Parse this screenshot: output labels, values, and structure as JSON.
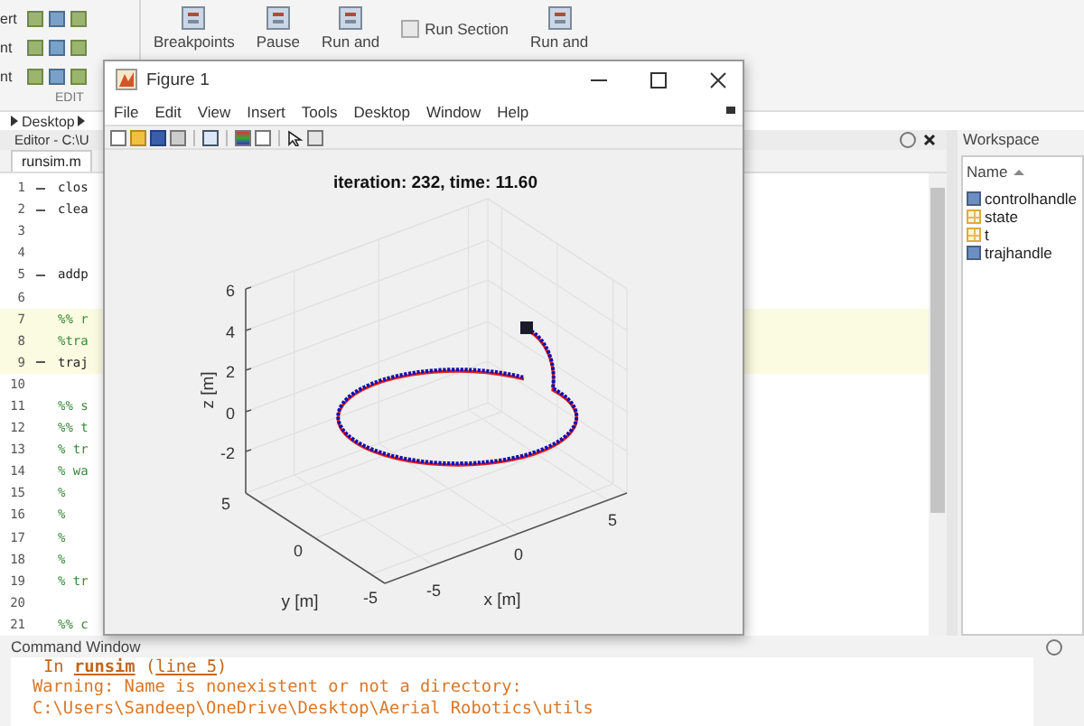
{
  "toolstrip": {
    "edit_rows": [
      "ert",
      "nt",
      "nt"
    ],
    "section_label": "EDIT",
    "buttons": [
      {
        "kind": "big",
        "label": "Breakpoints"
      },
      {
        "kind": "big",
        "label": "Pause"
      },
      {
        "kind": "big",
        "label": "Run and"
      },
      {
        "kind": "small",
        "label": "Run Section"
      },
      {
        "kind": "big",
        "label": "Run and"
      }
    ]
  },
  "address_bar": {
    "path": [
      "Desktop"
    ]
  },
  "editor": {
    "title": "Editor - C:\\U",
    "tabs": [
      {
        "label": "runsim.m",
        "selected": true
      }
    ],
    "lines": [
      {
        "number": "1",
        "executable": true,
        "cell": false,
        "code": "clos"
      },
      {
        "number": "2",
        "executable": true,
        "cell": false,
        "code": "clea"
      },
      {
        "number": "3",
        "executable": false,
        "cell": false
      },
      {
        "number": "4",
        "executable": false,
        "cell": false
      },
      {
        "number": "5",
        "executable": true,
        "cell": false,
        "code": "addp"
      },
      {
        "number": "6",
        "executable": false,
        "cell": false
      },
      {
        "number": "7",
        "executable": false,
        "cell": true,
        "code": "%% r"
      },
      {
        "number": "8",
        "executable": false,
        "cell": true,
        "code": "%tra"
      },
      {
        "number": "9",
        "executable": true,
        "cell": true,
        "code": "traj"
      },
      {
        "number": "10",
        "executable": false,
        "cell": false
      },
      {
        "number": "11",
        "executable": false,
        "cell": false,
        "code": "%% s"
      },
      {
        "number": "12",
        "executable": false,
        "cell": false,
        "code": "%% t"
      },
      {
        "number": "13",
        "executable": false,
        "cell": false,
        "code": "% tr"
      },
      {
        "number": "14",
        "executable": false,
        "cell": false,
        "code": "% wa"
      },
      {
        "number": "15",
        "executable": false,
        "cell": false,
        "code": "%"
      },
      {
        "number": "16",
        "executable": false,
        "cell": false,
        "code": "%"
      },
      {
        "number": "17",
        "executable": false,
        "cell": false,
        "code": "%"
      },
      {
        "number": "18",
        "executable": false,
        "cell": false,
        "code": "%"
      },
      {
        "number": "19",
        "executable": false,
        "cell": false,
        "code": "% tr"
      },
      {
        "number": "20",
        "executable": false,
        "cell": false
      },
      {
        "number": "21",
        "executable": false,
        "cell": false,
        "code": "%% c"
      }
    ]
  },
  "figure": {
    "title": "Figure 1",
    "menu": [
      "File",
      "Edit",
      "View",
      "Insert",
      "Tools",
      "Desktop",
      "Window",
      "Help"
    ],
    "plot": {
      "title": "iteration: 232, time: 11.60",
      "xlabel": "x [m]",
      "ylabel": "y [m]",
      "zlabel": "z [m]",
      "xticks": [
        "-5",
        "0",
        "5"
      ],
      "yticks": [
        "5",
        "0",
        "-5"
      ],
      "zticks": [
        "6",
        "4",
        "2",
        "0",
        "-2"
      ]
    }
  },
  "workspace": {
    "title": "Workspace",
    "column": "Name",
    "items": [
      {
        "name": "controlhandle",
        "kind": "object"
      },
      {
        "name": "state",
        "kind": "matrix"
      },
      {
        "name": "t",
        "kind": "matrix"
      },
      {
        "name": "trajhandle",
        "kind": "object"
      }
    ]
  },
  "command_window": {
    "title": "Command Window",
    "lines": [
      {
        "kind": "trace",
        "prefix": "In",
        "link": "runsim",
        "open": "(",
        "location": "line 5",
        "close": ")"
      },
      {
        "kind": "warning",
        "text": "Warning: Name is nonexistent or not a directory: C:\\Users\\Sandeep\\OneDrive\\Desktop\\Aerial Robotics\\utils"
      }
    ]
  }
}
